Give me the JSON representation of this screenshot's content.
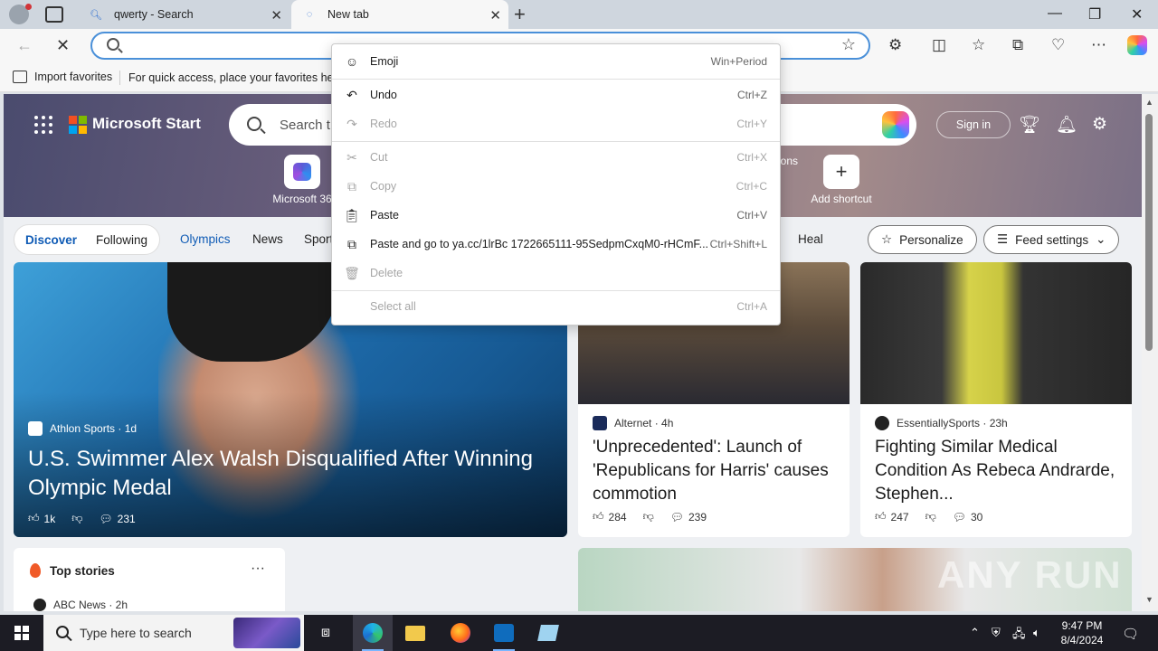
{
  "browser": {
    "tabs": [
      {
        "title": "qwerty - Search",
        "state": "inactive"
      },
      {
        "title": "New tab",
        "state": "active"
      }
    ],
    "address_placeholder": "",
    "favorites_bar": {
      "import_label": "Import favorites",
      "hint": "For quick access, place your favorites here"
    }
  },
  "start_page": {
    "brand": "Microsoft Start",
    "search_placeholder": "Search t",
    "sign_in": "Sign in",
    "shortcuts": [
      {
        "label": "Microsoft 36",
        "icon": "microsoft-365-icon"
      },
      {
        "label": "ons",
        "icon": "hidden"
      },
      {
        "label": "Add shortcut",
        "icon": "plus-icon"
      }
    ],
    "feed_tabs": [
      "Discover",
      "Following"
    ],
    "nav_links": [
      "Olympics",
      "News",
      "Sport",
      "Heal"
    ],
    "personalize": "Personalize",
    "feed_settings": "Feed settings",
    "cards": [
      {
        "source": "Athlon Sports · 1d",
        "headline": "U.S. Swimmer Alex Walsh Disqualified After Winning Olympic Medal",
        "likes": "1k",
        "comments": "231"
      },
      {
        "source": "Alternet · 4h",
        "headline": "'Unprecedented': Launch of 'Republicans for Harris' causes commotion",
        "likes": "284",
        "comments": "239"
      },
      {
        "source": "EssentiallySports · 23h",
        "headline": "Fighting Similar Medical Condition As Rebeca Andrarde, Stephen...",
        "likes": "247",
        "comments": "30"
      }
    ],
    "top_stories": {
      "title": "Top stories",
      "more": "···",
      "first_source": "ABC News · 2h"
    },
    "watermark": "ANY RUN"
  },
  "context_menu": {
    "items": [
      {
        "label": "Emoji",
        "shortcut": "Win+Period",
        "enabled": true,
        "icon": "emoji-icon"
      },
      {
        "label": "Undo",
        "shortcut": "Ctrl+Z",
        "enabled": true,
        "icon": "undo-icon"
      },
      {
        "label": "Redo",
        "shortcut": "Ctrl+Y",
        "enabled": false,
        "icon": "redo-icon"
      },
      {
        "label": "Cut",
        "shortcut": "Ctrl+X",
        "enabled": false,
        "icon": "cut-icon"
      },
      {
        "label": "Copy",
        "shortcut": "Ctrl+C",
        "enabled": false,
        "icon": "copy-icon"
      },
      {
        "label": "Paste",
        "shortcut": "Ctrl+V",
        "enabled": true,
        "icon": "paste-icon"
      },
      {
        "label": "Paste and go to ya.cc/1lrBc 1722665111-95SedpmCxqM0-rHCmF...",
        "shortcut": "Ctrl+Shift+L",
        "enabled": true,
        "icon": "paste-go-icon"
      },
      {
        "label": "Delete",
        "shortcut": "",
        "enabled": false,
        "icon": "delete-icon"
      },
      {
        "label": "Select all",
        "shortcut": "Ctrl+A",
        "enabled": false,
        "icon": "none"
      }
    ]
  },
  "taskbar": {
    "search_placeholder": "Type here to search",
    "time": "9:47 PM",
    "date": "8/4/2024"
  },
  "colors": {
    "accent": "#4a90d9",
    "taskbar": "#1c1c24",
    "menu_disabled": "#a6a6a6"
  }
}
